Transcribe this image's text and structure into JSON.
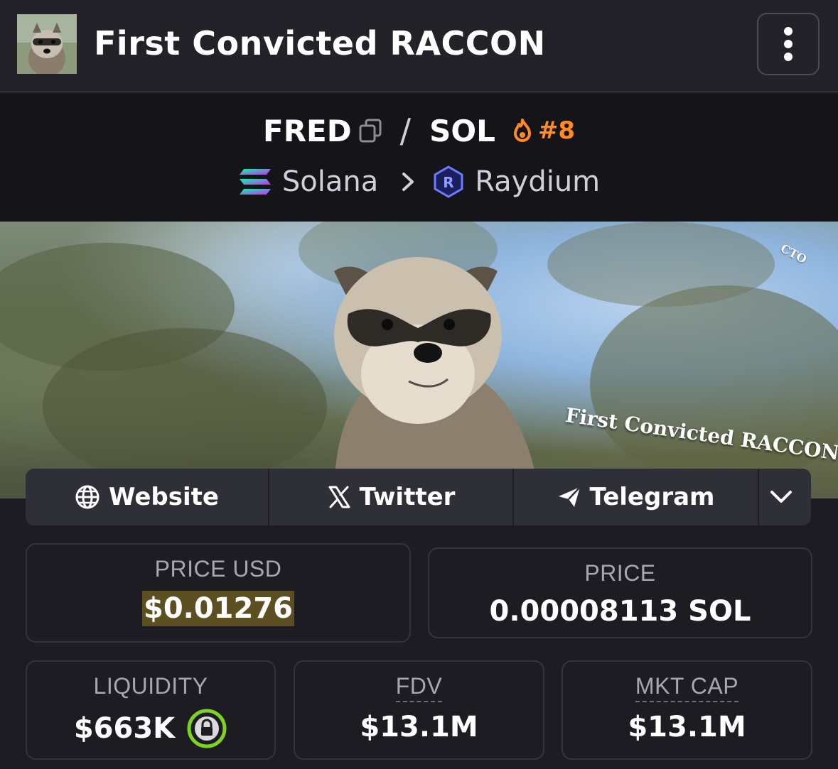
{
  "header": {
    "token_name": "First Convicted RACCON",
    "menu_icon": "more-vertical-icon"
  },
  "pair": {
    "base": "FRED",
    "separator": "/",
    "quote": "SOL",
    "trending_rank": "#8",
    "trending_color": "#ff8a1f"
  },
  "chain": {
    "name": "Solana",
    "dex": "Raydium"
  },
  "banner": {
    "tag": "CTO",
    "caption": "First Convicted RACCON"
  },
  "links": {
    "website": "Website",
    "twitter": "Twitter",
    "telegram": "Telegram"
  },
  "stats": {
    "price_usd_label": "PRICE USD",
    "price_usd_value": "$0.01276",
    "price_label": "PRICE",
    "price_value": "0.00008113 SOL",
    "liquidity_label": "LIQUIDITY",
    "liquidity_value": "$663K",
    "fdv_label": "FDV",
    "fdv_value": "$13.1M",
    "mktcap_label": "MKT CAP",
    "mktcap_value": "$13.1M"
  },
  "colors": {
    "background": "#1c1c22",
    "header": "#222228",
    "pair_section": "#141419",
    "highlight": "#5c4f22",
    "liquidity_lock": "#7ed321"
  }
}
